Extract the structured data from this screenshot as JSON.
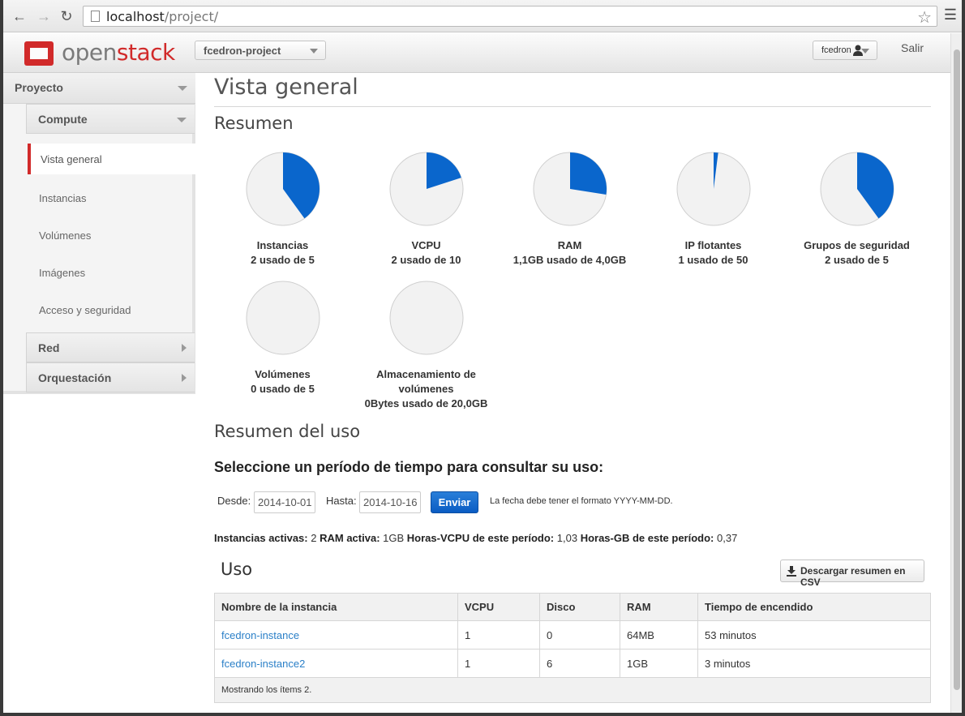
{
  "browser": {
    "url_host": "localhost",
    "url_path": "/project/"
  },
  "header": {
    "logo_open": "open",
    "logo_stack": "stack",
    "project": "fcedron-project",
    "user": "fcedron",
    "logout": "Salir",
    "brand_color": "#d12a2a"
  },
  "sidebar": {
    "section": "Proyecto",
    "subsection": "Compute",
    "items": [
      "Vista general",
      "Instancias",
      "Volúmenes",
      "Imágenes",
      "Acceso y seguridad"
    ],
    "active_item": "Vista general",
    "other_sections": [
      "Red",
      "Orquestación"
    ]
  },
  "main": {
    "title": "Vista general",
    "summary_title": "Resumen",
    "usage_summary_title": "Resumen del uso",
    "period_title": "Seleccione un período de tiempo para consultar su uso:",
    "from_label": "Desde:",
    "from_value": "2014-10-01",
    "to_label": "Hasta:",
    "to_value": "2014-10-16",
    "submit_label": "Enviar",
    "date_help": "La fecha debe tener el formato YYYY-MM-DD.",
    "stats": {
      "active_instances_label": "Instancias activas:",
      "active_instances": "2",
      "active_ram_label": "RAM activa:",
      "active_ram": "1GB",
      "vcpu_hours_label": "Horas-VCPU de este período:",
      "vcpu_hours": "1,03",
      "gb_hours_label": "Horas-GB de este período:",
      "gb_hours": "0,37"
    },
    "uso_title": "Uso",
    "csv_label": "Descargar resumen en CSV"
  },
  "quotas": [
    {
      "name": "Instancias",
      "usage": "2 usado de 5",
      "used": 2,
      "total": 5
    },
    {
      "name": "VCPU",
      "usage": "2 usado de 10",
      "used": 2,
      "total": 10
    },
    {
      "name": "RAM",
      "usage": "1,1GB usado de 4,0GB",
      "used": 1.1,
      "total": 4.0
    },
    {
      "name": "IP flotantes",
      "usage": "1 usado de 50",
      "used": 1,
      "total": 50
    },
    {
      "name": "Grupos de seguridad",
      "usage": "2 usado de 5",
      "used": 2,
      "total": 5
    },
    {
      "name": "Volúmenes",
      "usage": "0 usado de 5",
      "used": 0,
      "total": 5
    },
    {
      "name": "Almacenamiento de volúmenes",
      "usage": "0Bytes usado de 20,0GB",
      "used": 0,
      "total": 20
    }
  ],
  "pie_colors": {
    "used": "#0a66cc",
    "free": "#f2f2f2",
    "border": "#cfcfcf"
  },
  "table": {
    "columns": [
      "Nombre de la instancia",
      "VCPU",
      "Disco",
      "RAM",
      "Tiempo de encendido"
    ],
    "rows": [
      [
        "fcedron-instance",
        "1",
        "0",
        "64MB",
        "53 minutos"
      ],
      [
        "fcedron-instance2",
        "1",
        "6",
        "1GB",
        "3 minutos"
      ]
    ],
    "footer": "Mostrando los ítems 2."
  }
}
